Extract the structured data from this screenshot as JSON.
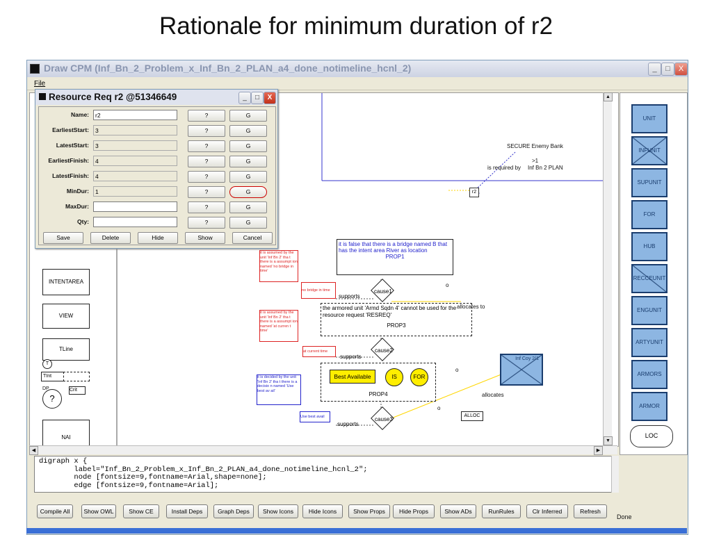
{
  "slide": {
    "title": "Rationale for minimum duration of r2"
  },
  "app": {
    "title": "Draw CPM (Inf_Bn_2_Problem_x_Inf_Bn_2_PLAN_a4_done_notimeline_hcnl_2)",
    "menu": [
      "File"
    ],
    "window_controls": [
      "_",
      "□",
      "X"
    ]
  },
  "dialog": {
    "title": "Resource Req r2 @51346649",
    "controls": [
      "_",
      "□",
      "X"
    ],
    "rows": [
      {
        "label": "Name:",
        "value": "r2",
        "q": "?",
        "g": "G"
      },
      {
        "label": "EarliestStart:",
        "value": "3",
        "q": "?",
        "g": "G"
      },
      {
        "label": "LatestStart:",
        "value": "3",
        "q": "?",
        "g": "G"
      },
      {
        "label": "EarliestFinish:",
        "value": "4",
        "q": "?",
        "g": "G"
      },
      {
        "label": "LatestFinish:",
        "value": "4",
        "q": "?",
        "g": "G"
      },
      {
        "label": "MinDur:",
        "value": "1",
        "q": "?",
        "g": "G"
      },
      {
        "label": "MaxDur:",
        "value": "",
        "q": "?",
        "g": "G"
      },
      {
        "label": "Qty:",
        "value": "",
        "q": "?",
        "g": "G"
      }
    ],
    "buttons": [
      "Save",
      "Delete",
      "Hide",
      "Show",
      "Cancel"
    ]
  },
  "canvas": {
    "left_items": [
      "INTENTAREA",
      "VIEW",
      "TLine",
      "T",
      "TInt",
      "DP",
      "?",
      "Crit",
      "NAI"
    ],
    "secure": "SECURE Enemy Bank",
    "gt1": ">1",
    "required": "is required by",
    "plan": "Inf Bn 2 PLAN",
    "r2": "r2",
    "prop1_text": "it is false that there is a bridge named B that has the intent area River as location",
    "prop1": "PROP1",
    "prop3_text": "the armored unit 'Armd Sqdn 4' cannot be used for the resource request 'RESREQ'",
    "prop3": "PROP3",
    "prop4": "PROP4",
    "best": "Best Available",
    "is": "IS",
    "for": "FOR",
    "supports": "supports",
    "cause1": "cause1",
    "cause2": "cause2",
    "cause3": "cause3",
    "allocates_to": "allocates to",
    "allocates": "allocates",
    "alloc": "ALLOC",
    "o": "o",
    "infcoy": "Inf Coy 2/1",
    "red1": "it is assumed by the unit 'Inf Bn 2' tha t there is a assumpt ion named 'no bridge in time'",
    "red1b": "no bridge in time",
    "red2": "it is assumed by the unit 'Inf Bn 2' tha t there is a assumpt ion named 'at curren t time'",
    "red2b": "at current time",
    "blue1": "it is decided by the unit 'Inf Bn 2' tha t there is a decisio n named 'Use best av ail'",
    "blue1b": "Use best avail"
  },
  "palette": {
    "items": [
      "UNIT",
      "INFUNIT",
      "SUPUNIT",
      "FOR",
      "HUB",
      "RECCEUNIT",
      "ENGUNIT",
      "ARTYUNIT",
      "ARMORS",
      "ARMOR"
    ],
    "loc": "LOC"
  },
  "code": {
    "lines": [
      "digraph x {",
      "        label=\"Inf_Bn_2_Problem_x_Inf_Bn_2_PLAN_a4_done_notimeline_hcnl_2\";",
      "        node [fontsize=9,fontname=Arial,shape=none];",
      "        edge [fontsize=9,fontname=Arial];"
    ]
  },
  "toolbar": {
    "buttons": [
      "Compile All",
      "Show OWL",
      "Show CE",
      "Install Deps",
      "Graph Deps",
      "Show Icons",
      "Hide Icons",
      "Show Props",
      "Hide Props",
      "Show ADs",
      "RunRules",
      "Clr Inferred",
      "Refresh"
    ],
    "status": "Done"
  },
  "colors": {
    "accent_red": "#cc0000",
    "node_blue": "#8db6e2",
    "link_blue": "#3333cc",
    "yellow": "#ffee00"
  }
}
